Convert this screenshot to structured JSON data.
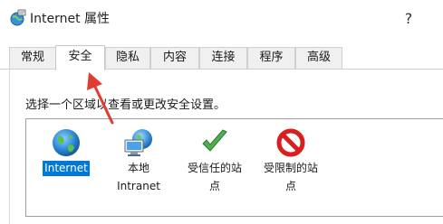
{
  "window": {
    "title": "Internet 属性",
    "help": "?"
  },
  "tabs": [
    {
      "label": "常规"
    },
    {
      "label": "安全"
    },
    {
      "label": "隐私"
    },
    {
      "label": "内容"
    },
    {
      "label": "连接"
    },
    {
      "label": "程序"
    },
    {
      "label": "高级"
    }
  ],
  "active_tab": "安全",
  "security": {
    "instruction": "选择一个区域以查看或更改安全设置。",
    "zones": [
      {
        "line1": "Internet",
        "line2": "",
        "icon": "globe-icon",
        "selected": true
      },
      {
        "line1": "本地",
        "line2": "Intranet",
        "icon": "intranet-icon",
        "selected": false
      },
      {
        "line1": "受信任的站",
        "line2": "点",
        "icon": "check-icon",
        "selected": false
      },
      {
        "line1": "受限制的站",
        "line2": "点",
        "icon": "prohibited-icon",
        "selected": false
      }
    ]
  },
  "colors": {
    "selection": "#0078d7",
    "arrow": "#e03c31",
    "check": "#3ca83c",
    "prohibited": "#d81e1e"
  }
}
